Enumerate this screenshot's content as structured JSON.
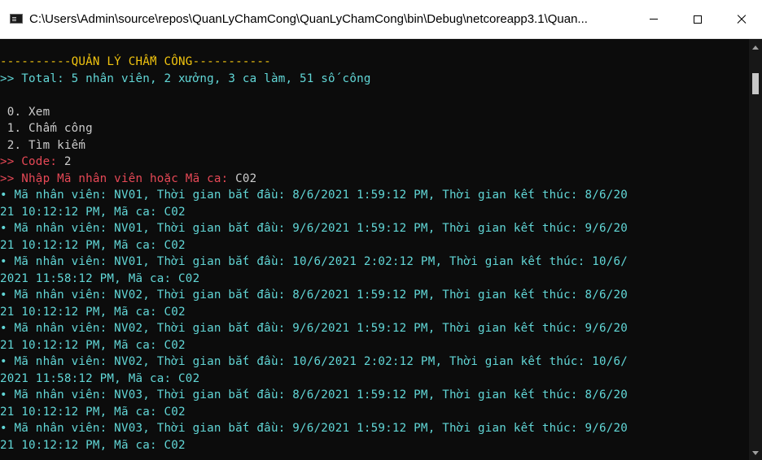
{
  "window": {
    "title": "C:\\Users\\Admin\\source\\repos\\QuanLyChamCong\\QuanLyChamCong\\bin\\Debug\\netcoreapp3.1\\Quan...",
    "icon": "console-icon",
    "controls": {
      "minimize": "minimize-icon",
      "maximize": "maximize-icon",
      "close": "close-icon"
    }
  },
  "console": {
    "header": "----------QUẢN LÝ CHẤM CÔNG-----------",
    "total": ">> Total: 5 nhân viên, 2 xưởng, 3 ca làm, 51 số công",
    "menu": [
      " 0. Xem",
      " 1. Chấm công",
      " 2. Tìm kiếm"
    ],
    "code_prompt": ">> Code: ",
    "code_value": "2",
    "search_prompt": ">> Nhập Mã nhân viên hoặc Mã ca: ",
    "search_value": "C02",
    "results": [
      "• Mã nhân viên: NV01, Thời gian bắt đầu: 8/6/2021 1:59:12 PM, Thời gian kết thúc: 8/6/20",
      "21 10:12:12 PM, Mã ca: C02",
      "• Mã nhân viên: NV01, Thời gian bắt đầu: 9/6/2021 1:59:12 PM, Thời gian kết thúc: 9/6/20",
      "21 10:12:12 PM, Mã ca: C02",
      "• Mã nhân viên: NV01, Thời gian bắt đầu: 10/6/2021 2:02:12 PM, Thời gian kết thúc: 10/6/",
      "2021 11:58:12 PM, Mã ca: C02",
      "• Mã nhân viên: NV02, Thời gian bắt đầu: 8/6/2021 1:59:12 PM, Thời gian kết thúc: 8/6/20",
      "21 10:12:12 PM, Mã ca: C02",
      "• Mã nhân viên: NV02, Thời gian bắt đầu: 9/6/2021 1:59:12 PM, Thời gian kết thúc: 9/6/20",
      "21 10:12:12 PM, Mã ca: C02",
      "• Mã nhân viên: NV02, Thời gian bắt đầu: 10/6/2021 2:02:12 PM, Thời gian kết thúc: 10/6/",
      "2021 11:58:12 PM, Mã ca: C02",
      "• Mã nhân viên: NV03, Thời gian bắt đầu: 8/6/2021 1:59:12 PM, Thời gian kết thúc: 8/6/20",
      "21 10:12:12 PM, Mã ca: C02",
      "• Mã nhân viên: NV03, Thời gian bắt đầu: 9/6/2021 1:59:12 PM, Thời gian kết thúc: 9/6/20",
      "21 10:12:12 PM, Mã ca: C02"
    ]
  },
  "colors": {
    "background": "#0c0c0c",
    "header": "#f1c40f",
    "info": "#61d6d6",
    "default_text": "#cccccc",
    "prompt": "#e74856"
  }
}
